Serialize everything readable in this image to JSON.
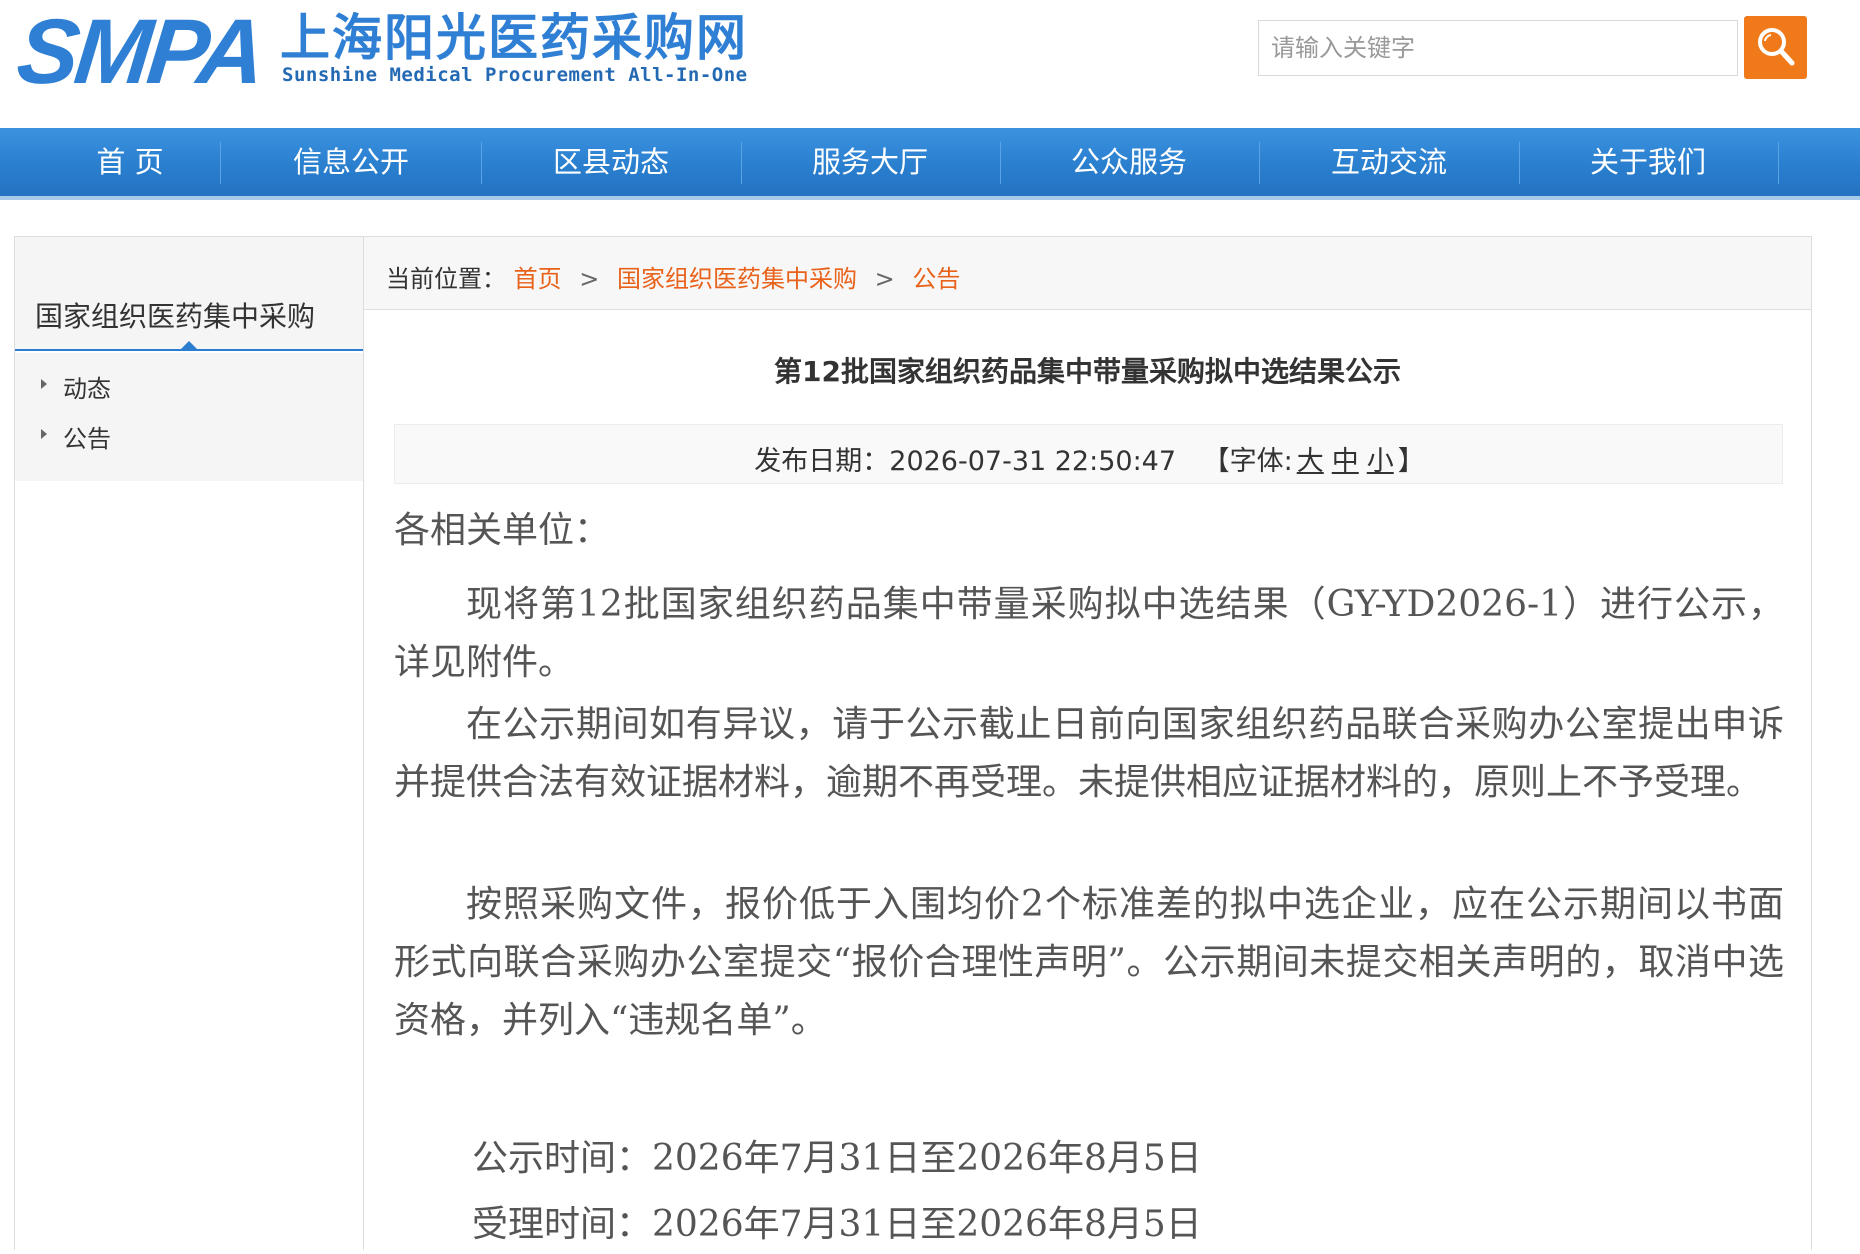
{
  "header": {
    "logo_abbr": "SMPA",
    "logo_cn": "上海阳光医药采购网",
    "logo_en": "Sunshine Medical Procurement All-In-One",
    "search_placeholder": "请输入关键字",
    "search_icon": "search-icon"
  },
  "nav": {
    "items": [
      "首 页",
      "信息公开",
      "区县动态",
      "服务大厅",
      "公众服务",
      "互动交流",
      "关于我们"
    ]
  },
  "sidebar": {
    "title": "国家组织医药集中采购",
    "items": [
      "动态",
      "公告"
    ]
  },
  "breadcrumb": {
    "prefix": "当前位置：",
    "items": [
      "首页",
      "国家组织医药集中采购",
      "公告"
    ],
    "separator": ">"
  },
  "article": {
    "title": "第12批国家组织药品集中带量采购拟中选结果公示",
    "date_label": "发布日期：2026-07-31 22:50:47",
    "font_label_open": "【字体:",
    "font_sizes": [
      "大",
      "中",
      "小"
    ],
    "font_label_close": "】",
    "salutation": "各相关单位：",
    "paragraphs": [
      "现将第12批国家组织药品集中带量采购拟中选结果（GY-YD2026-1）进行公示，详见附件。",
      "在公示期间如有异议，请于公示截止日前向国家组织药品联合采购办公室提出申诉并提供合法有效证据材料，逾期不再受理。未提供相应证据材料的，原则上不予受理。",
      "按照采购文件，报价低于入围均价2个标准差的拟中选企业，应在公示期间以书面形式向联合采购办公室提交“报价合理性声明”。公示期间未提交相关声明的，取消中选资格，并列入“违规名单”。"
    ],
    "publicity_time": "公示时间：2026年7月31日至2026年8月5日",
    "acceptance_time": "受理时间：2026年7月31日至2026年8月5日"
  },
  "colors": {
    "brand_blue": "#2f7fd4",
    "nav_blue": "#2a7fcf",
    "accent_orange": "#e8621a",
    "search_button": "#f07a1a"
  }
}
